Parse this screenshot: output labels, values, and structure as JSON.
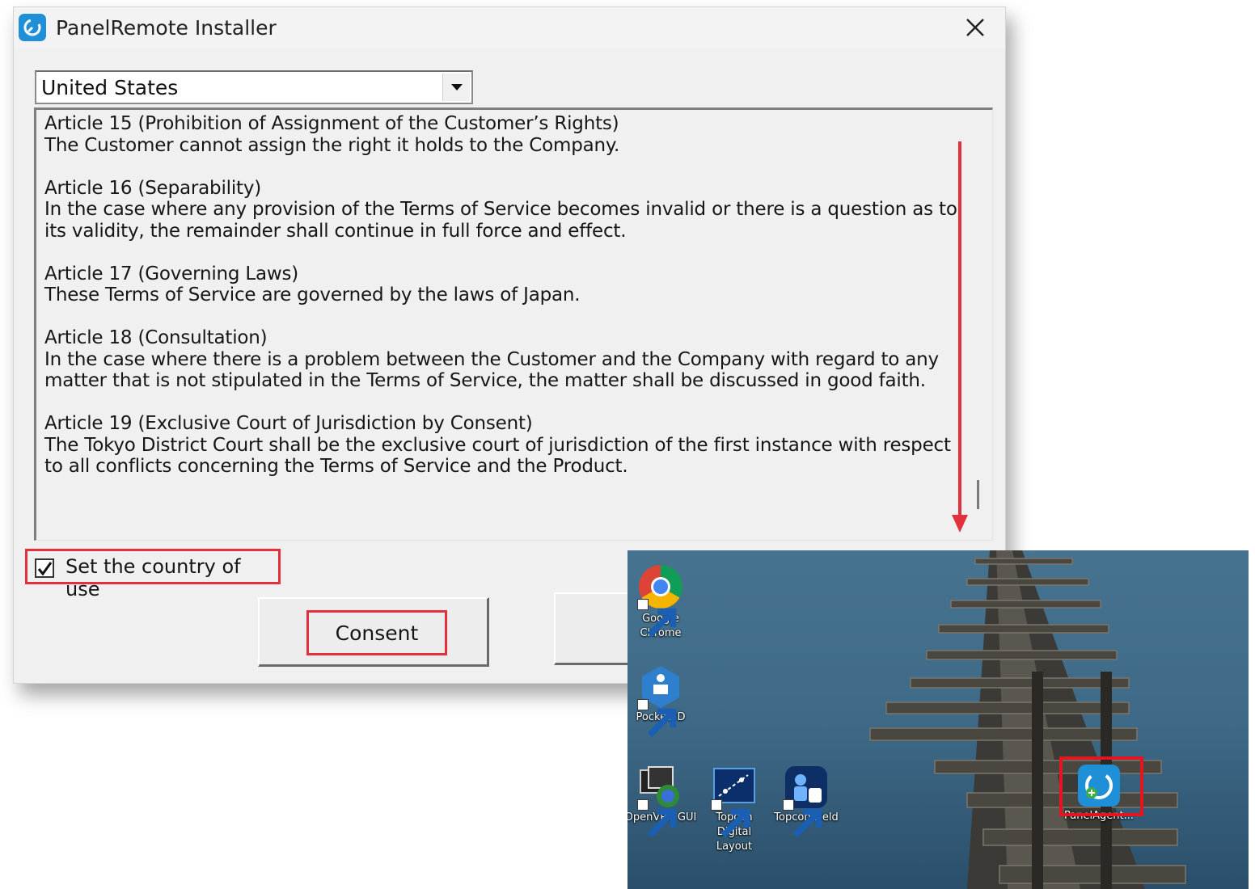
{
  "window": {
    "title": "PanelRemote Installer",
    "app_icon": "panelremote-logo-icon",
    "close_icon": "close-icon"
  },
  "country_select": {
    "value": "United States",
    "dropdown_icon": "chevron-down-icon"
  },
  "terms": {
    "paragraphs": [
      "Article 15 (Prohibition of Assignment of the Customer’s Rights)\nThe Customer cannot assign the right it holds to the Company.",
      "Article 16 (Separability)\nIn the case where any provision of the Terms of Service becomes invalid or there is a question as to its validity, the remainder shall continue in full force and effect.",
      "Article 17 (Governing Laws)\nThese Terms of Service are governed by the laws of Japan.",
      "Article 18 (Consultation)\nIn the case where there is a problem between the Customer and the Company with regard to any matter that is not stipulated in the Terms of Service, the matter shall be discussed in good faith.",
      "Article 19 (Exclusive Court of Jurisdiction by Consent)\nThe Tokyo District Court shall be the exclusive court of jurisdiction of the first instance with respect to all conflicts concerning the Terms of Service and the Product."
    ]
  },
  "checkbox": {
    "label": "Set the country of use",
    "checked": true
  },
  "buttons": {
    "consent_label": "Consent"
  },
  "annotation_color": "#e3303b",
  "desktop": {
    "icons": [
      {
        "label": "Google Chrome",
        "icon": "chrome-icon"
      },
      {
        "label": "Pocket3D",
        "icon": "pocket3d-icon"
      },
      {
        "label": "OpenVPN GUI",
        "icon": "openvpn-icon"
      },
      {
        "label": "Topcon Digital Layout",
        "icon": "topcon-layout-icon"
      },
      {
        "label": "Topcon Field",
        "icon": "topcon-field-icon"
      },
      {
        "label": "PanelAgent...",
        "icon": "panelagent-icon"
      }
    ]
  }
}
